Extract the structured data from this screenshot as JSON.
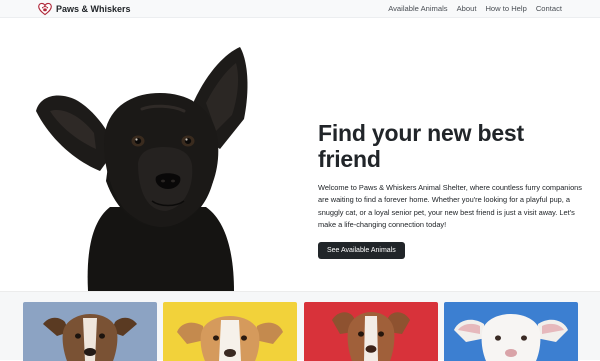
{
  "navbar": {
    "brand_name": "Paws & Whiskers",
    "brand_icon": "heart-paw-logo",
    "links": [
      "Available Animals",
      "About",
      "How to Help",
      "Contact"
    ]
  },
  "hero": {
    "title": "Find your new best friend",
    "lead": "Welcome to Paws & Whiskers Animal Shelter, where countless furry companions are waiting to find a forever home. Whether you're looking for a playful pup, a snuggly cat, or a loyal senior pet, your new best friend is just a visit away. Let's make a life-changing connection today!",
    "cta_label": "See Available Animals",
    "photo": "black-dog-photo"
  },
  "gallery": {
    "cards": [
      {
        "photo": "brindle-dog-photo",
        "background": "#8ca3c3"
      },
      {
        "photo": "tan-white-dog-photo",
        "background": "#f2d23a"
      },
      {
        "photo": "brown-white-dog-photo",
        "background": "#d8323a"
      },
      {
        "photo": "white-dog-photo",
        "background": "#3c7fd1"
      }
    ]
  },
  "colors": {
    "navbar_bg": "#f8f9fa",
    "text": "#212529",
    "button_bg": "#212529",
    "gallery_bg": "#f6f7f8"
  }
}
